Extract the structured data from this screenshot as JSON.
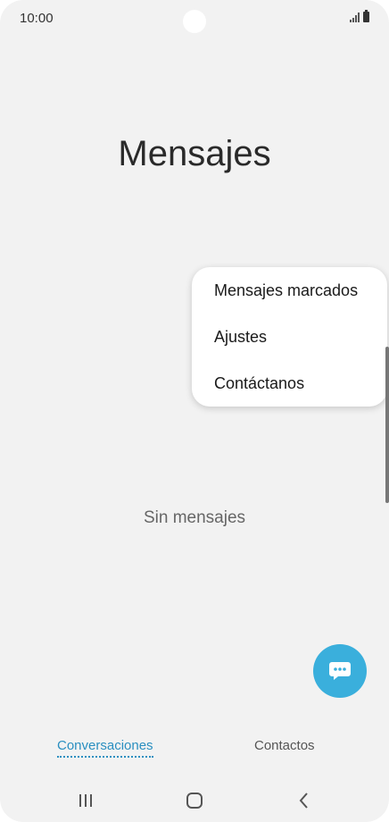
{
  "status_bar": {
    "time": "10:00"
  },
  "app": {
    "title": "Mensajes"
  },
  "menu": {
    "items": [
      {
        "label": "Mensajes marcados"
      },
      {
        "label": "Ajustes"
      },
      {
        "label": "Contáctanos"
      }
    ]
  },
  "empty_state": {
    "text": "Sin mensajes"
  },
  "fab": {
    "icon": "chat-bubble-icon",
    "color": "#3aafdc"
  },
  "tabs": [
    {
      "label": "Conversaciones",
      "active": true
    },
    {
      "label": "Contactos",
      "active": false
    }
  ],
  "nav_bar": {
    "recents_icon": "recent-apps-icon",
    "home_icon": "home-icon",
    "back_icon": "back-icon"
  },
  "colors": {
    "accent": "#2a8fc0",
    "background": "#f2f2f2"
  }
}
